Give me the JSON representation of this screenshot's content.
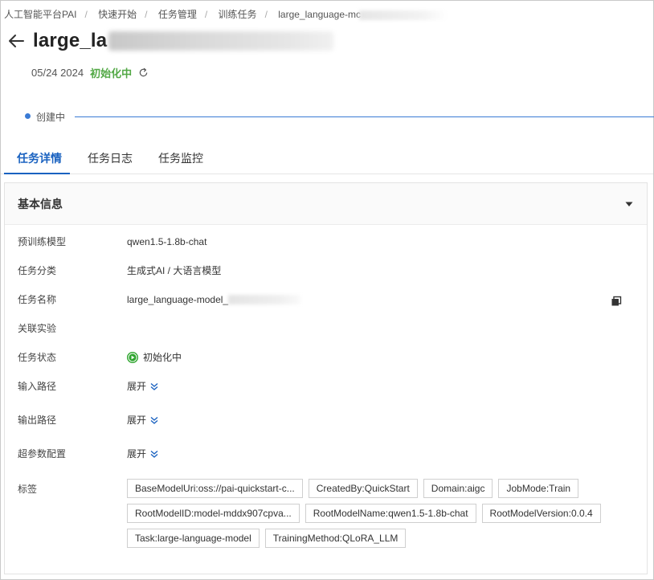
{
  "breadcrumb": {
    "items": [
      "人工智能平台PAI",
      "快速开始",
      "任务管理",
      "训练任务",
      "large_language-mc"
    ]
  },
  "header": {
    "title_visible": "large_la",
    "date": "05/24 2024",
    "status": "初始化中"
  },
  "progress": {
    "step_label": "创建中"
  },
  "tabs": [
    {
      "label": "任务详情",
      "active": true
    },
    {
      "label": "任务日志",
      "active": false
    },
    {
      "label": "任务监控",
      "active": false
    }
  ],
  "panel": {
    "title": "基本信息",
    "fields": {
      "pretrained_model": {
        "key": "预训练模型",
        "value": "qwen1.5-1.8b-chat"
      },
      "category": {
        "key": "任务分类",
        "value": "生成式AI / 大语言模型"
      },
      "task_name": {
        "key": "任务名称",
        "value": "large_language-model_"
      },
      "experiment": {
        "key": "关联实验",
        "value": ""
      },
      "task_status": {
        "key": "任务状态",
        "value": "初始化中"
      },
      "input_path": {
        "key": "输入路径",
        "value": "展开"
      },
      "output_path": {
        "key": "输出路径",
        "value": "展开"
      },
      "hyperparams": {
        "key": "超参数配置",
        "value": "展开"
      },
      "tags_key": "标签"
    },
    "tags": [
      "BaseModelUri:oss://pai-quickstart-c...",
      "CreatedBy:QuickStart",
      "Domain:aigc",
      "JobMode:Train",
      "RootModelID:model-mddx907cpva...",
      "RootModelName:qwen1.5-1.8b-chat",
      "RootModelVersion:0.0.4",
      "Task:large-language-model",
      "TrainingMethod:QLoRA_LLM"
    ]
  },
  "colors": {
    "accent": "#1a62c0",
    "status_green": "#52a845",
    "progress_blue": "#3a7bd5"
  },
  "icons": [
    "back-arrow-icon",
    "refresh-icon",
    "caret-down-icon",
    "copy-icon",
    "play-circle-icon",
    "double-chevron-down-icon"
  ]
}
